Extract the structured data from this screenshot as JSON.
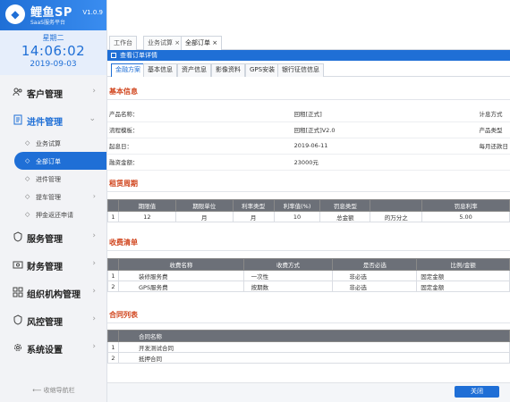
{
  "brand": {
    "title": "鲤鱼SP",
    "subtitle": "SaaS服务平台",
    "version": "V1.0.9"
  },
  "clock": {
    "weekday": "星期二",
    "time": "14:06:02",
    "date": "2019-09-03"
  },
  "sidebar": {
    "items": [
      {
        "label": "客户管理",
        "icon": "users-icon"
      },
      {
        "label": "进件管理",
        "icon": "document-icon"
      },
      {
        "label": "服务管理",
        "icon": "shield-icon"
      },
      {
        "label": "财务管理",
        "icon": "money-icon"
      },
      {
        "label": "组织机构管理",
        "icon": "org-icon"
      },
      {
        "label": "风控管理",
        "icon": "shield-icon"
      },
      {
        "label": "系统设置",
        "icon": "gear-icon"
      }
    ],
    "sub_items": [
      "业务试算",
      "全部订单",
      "进件管理",
      "提车管理",
      "押金返还申请"
    ],
    "collapse_label": "收缩导航栏"
  },
  "tabs": [
    "工作台",
    "业务试算",
    "全部订单"
  ],
  "panel_title": "查看订单详情",
  "subtabs": [
    "金融方案",
    "基本信息",
    "资产信息",
    "影像资料",
    "GPS安装",
    "银行征信信息"
  ],
  "basic_info": {
    "title": "基本信息",
    "rows": [
      {
        "l1": "产品名称：",
        "v1": "回租[正式]",
        "l2": "计息方式"
      },
      {
        "l1": "流程模板：",
        "v1": "回租[正式]V2.0",
        "l2": "产品类型"
      },
      {
        "l1": "起息日：",
        "v1": "2019-06-11",
        "l2": "每月还款日"
      },
      {
        "l1": "融资金额：",
        "v1": "23000元",
        "l2": ""
      }
    ]
  },
  "lease_cycle": {
    "title": "租赁周期",
    "headers": [
      "",
      "期限值",
      "期限单位",
      "利率类型",
      "利率值(%)",
      "罚息类型",
      "",
      "罚息利率"
    ],
    "rows": [
      [
        "1",
        "12",
        "月",
        "月",
        "10",
        "总金额",
        "的万分之",
        "5.00"
      ]
    ]
  },
  "fee_list": {
    "title": "收费清单",
    "headers": [
      "",
      "收费名称",
      "收费方式",
      "是否必选",
      "比例/金额"
    ],
    "rows": [
      [
        "1",
        "装修服务费",
        "一次性",
        "非必选",
        "固定金额"
      ],
      [
        "2",
        "GPS服务费",
        "按期数",
        "非必选",
        "固定金额"
      ]
    ]
  },
  "contracts": {
    "title": "合同列表",
    "headers": [
      "",
      "合同名称"
    ],
    "rows": [
      [
        "1",
        "开发测试合同"
      ],
      [
        "2",
        "抵押合同"
      ]
    ]
  },
  "footer": {
    "close_label": "关闭"
  },
  "colors": {
    "accent": "#1f6fd6",
    "section_title": "#d0431b",
    "table_header": "#6c7078"
  }
}
